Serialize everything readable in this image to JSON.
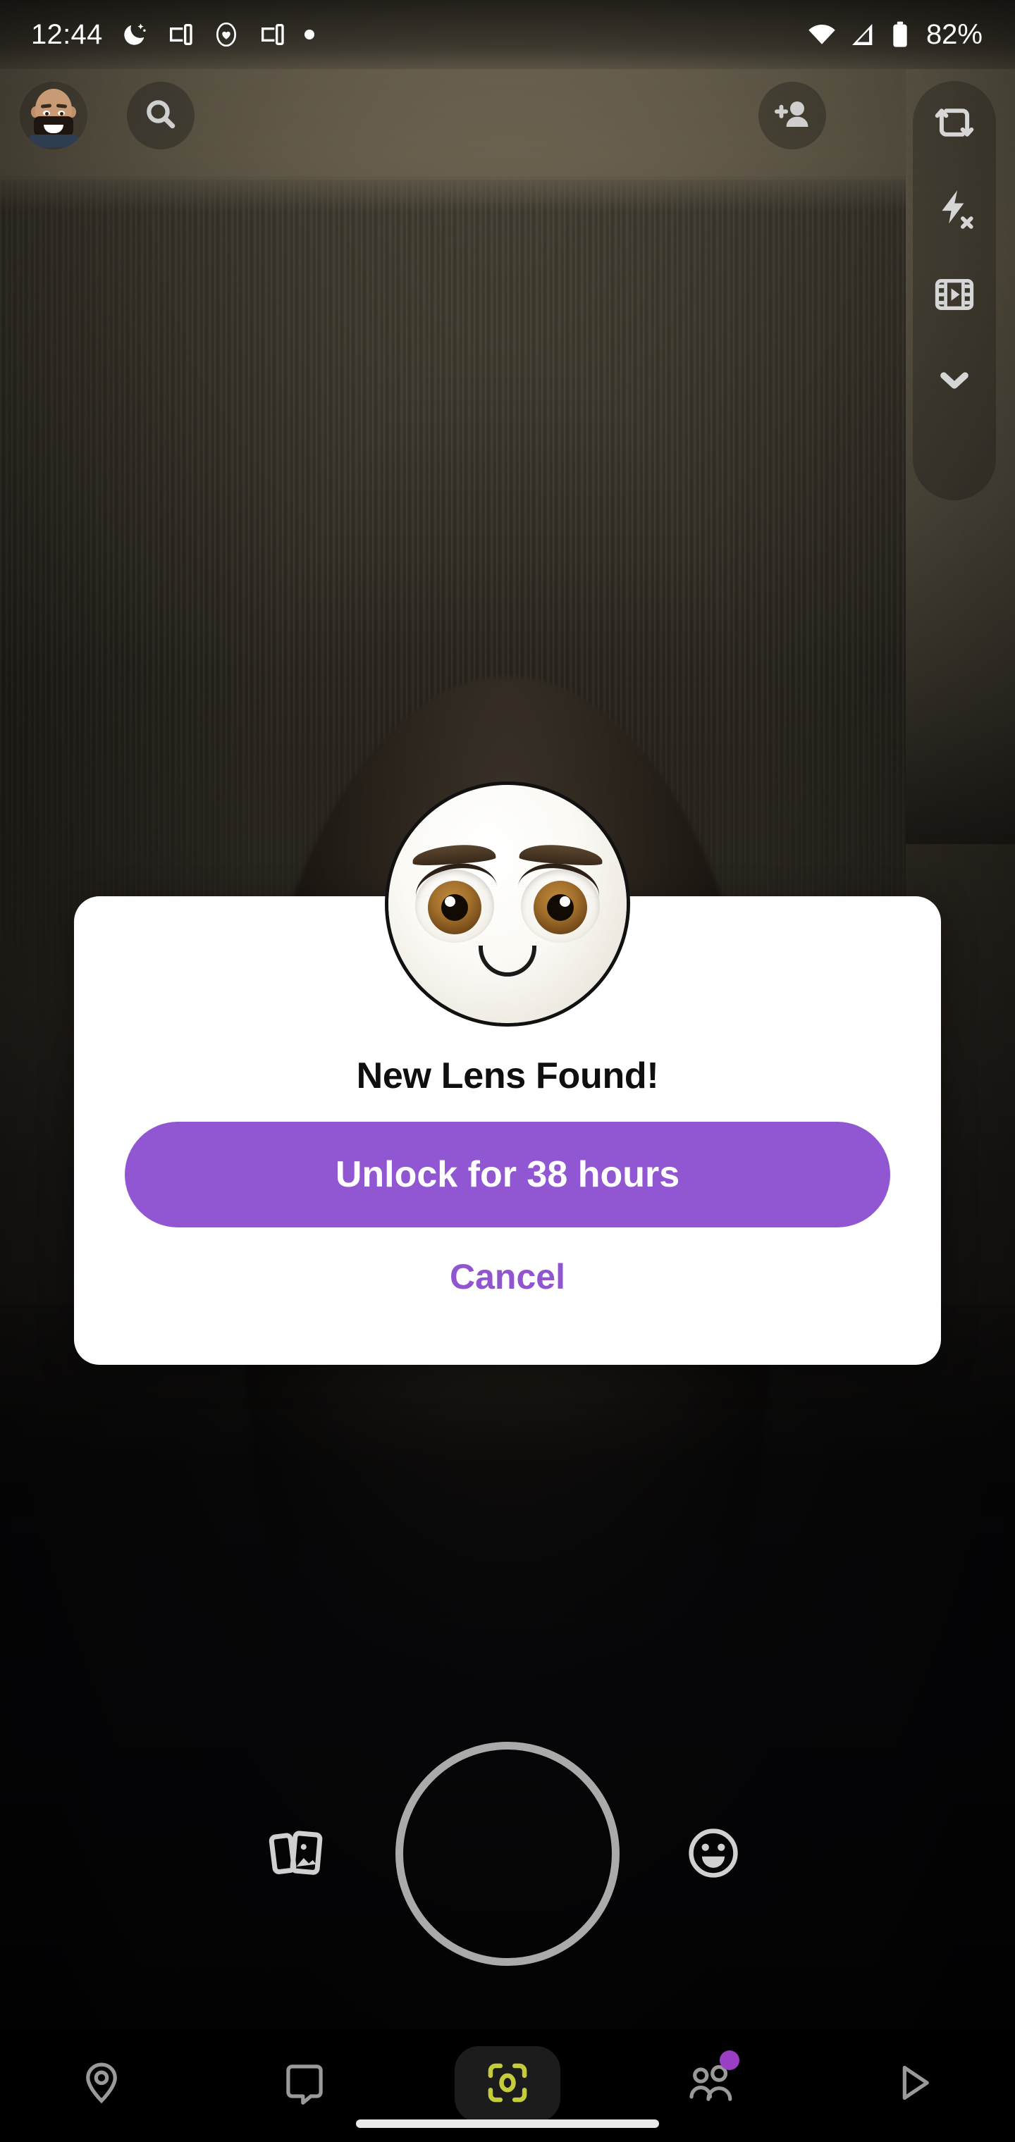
{
  "status_bar": {
    "time": "12:44",
    "battery_percent": "82%",
    "icons": [
      "do-not-disturb-moon-icon",
      "cast-device-icon",
      "heart-icon",
      "cast-device-icon",
      "status-dot-icon",
      "wifi-icon",
      "cellular-signal-icon",
      "battery-icon"
    ]
  },
  "top_controls": {
    "avatar_label": "profile-bitmoji-avatar",
    "search_label": "search-icon",
    "add_friend_label": "add-friend-icon"
  },
  "right_toolbar": {
    "items": [
      "flip-camera-icon",
      "flash-off-icon",
      "timer-filmstrip-icon",
      "chevron-down-icon"
    ]
  },
  "camera_row": {
    "memories_label": "memories-icon",
    "shutter_label": "shutter-button",
    "lens_carousel_label": "lens-carousel-smiley-icon"
  },
  "dialog": {
    "title": "New Lens Found!",
    "unlock_label": "Unlock for 38 hours",
    "cancel_label": "Cancel",
    "lens_preview": "white-cartoon-face-lens-icon",
    "accent_color": "#9155cf",
    "button_color": "#9157d2",
    "card_color": "#ffffff",
    "title_color": "#0f0f0f"
  },
  "bottom_nav": {
    "items": [
      {
        "name": "map",
        "icon": "map-pin-icon",
        "active": false,
        "badge": false
      },
      {
        "name": "chat",
        "icon": "chat-bubble-icon",
        "active": false,
        "badge": false
      },
      {
        "name": "camera",
        "icon": "camera-scan-icon",
        "active": true,
        "badge": false
      },
      {
        "name": "stories",
        "icon": "friends-people-icon",
        "active": false,
        "badge": true
      },
      {
        "name": "spotlight",
        "icon": "play-triangle-icon",
        "active": false,
        "badge": false
      }
    ],
    "active_color": "#c5cc3b",
    "inactive_color": "#9a9a9a",
    "badge_color": "#9a3fc4",
    "active_pill_color": "#1c1c1c"
  },
  "gesture_bar": {
    "label": "home-gesture-bar"
  }
}
